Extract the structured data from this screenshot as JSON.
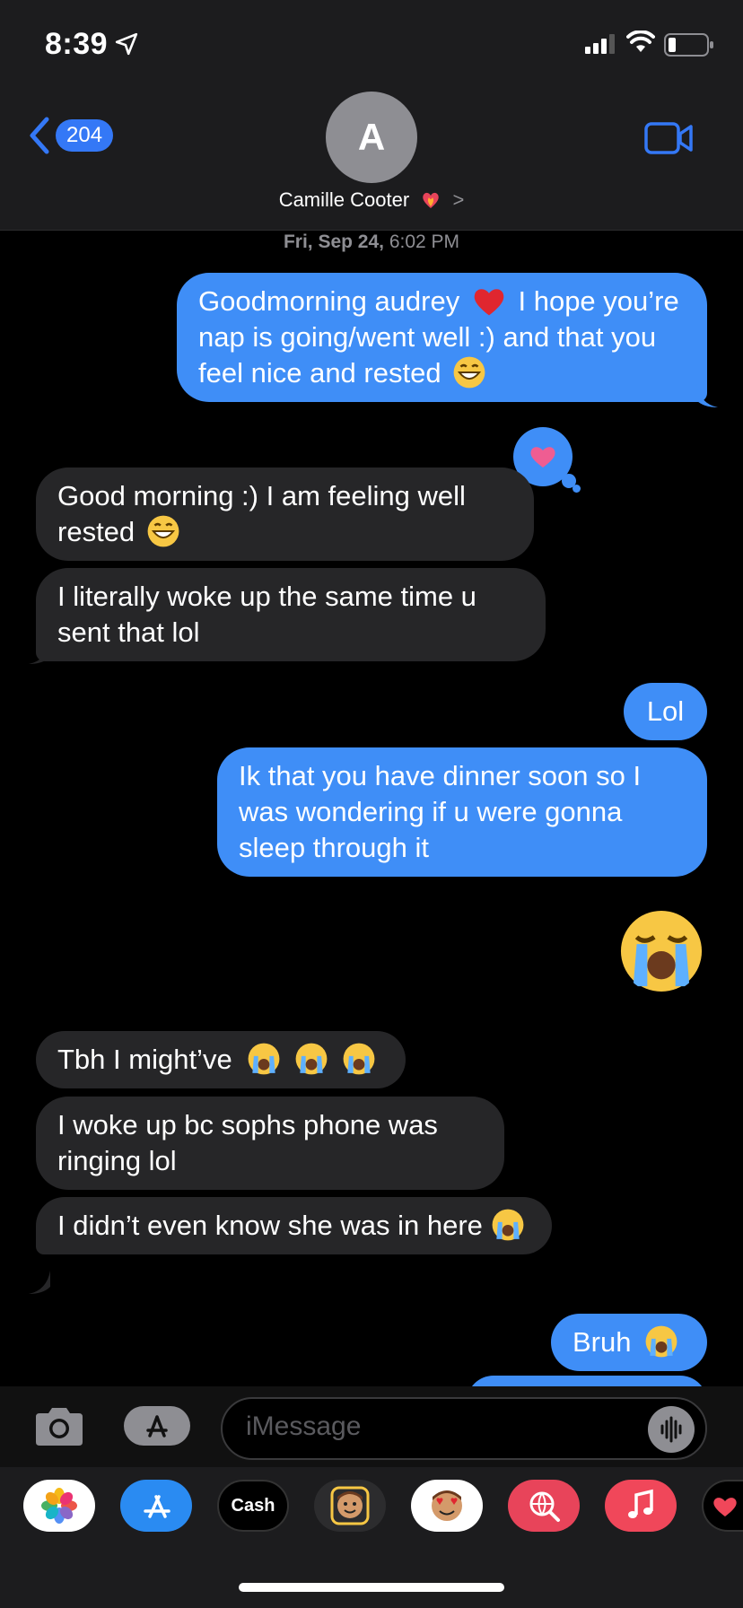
{
  "status_bar": {
    "time": "8:39"
  },
  "header": {
    "back_count": "204",
    "avatar_initial": "A",
    "contact_name": "Camille Cooter",
    "contact_chevron": ">"
  },
  "timestamp": {
    "day": "Fri, Sep 24,",
    "time": "6:02 PM"
  },
  "messages": [
    {
      "id": "m1",
      "direction": "sent",
      "text_a": "Goodmorning audrey",
      "text_b": "I hope you’re nap is going/went well :) and that you feel nice and rested"
    },
    {
      "id": "m2",
      "direction": "received",
      "text": "Good morning :) I am feeling well rested"
    },
    {
      "id": "m3",
      "direction": "received",
      "text": "I literally woke up the same time u sent that lol"
    },
    {
      "id": "m4",
      "direction": "sent",
      "text": "Lol"
    },
    {
      "id": "m5",
      "direction": "sent",
      "text": "Ik that you have dinner soon so I was wondering if u were gonna sleep through it"
    },
    {
      "id": "m6",
      "direction": "sent",
      "emoji": "loudly-crying-face"
    },
    {
      "id": "m7",
      "direction": "received",
      "text": "Tbh I might’ve"
    },
    {
      "id": "m8",
      "direction": "received",
      "text": "I woke up bc sophs phone was ringing lol"
    },
    {
      "id": "m9",
      "direction": "received",
      "text": "I didn’t even know she was in here"
    },
    {
      "id": "m10",
      "direction": "sent",
      "text": "Bruh"
    }
  ],
  "input": {
    "placeholder": "iMessage"
  },
  "app_drawer": {
    "apps": [
      {
        "name": "photos",
        "label": ""
      },
      {
        "name": "app-store",
        "label": ""
      },
      {
        "name": "apple-cash",
        "label": "Cash"
      },
      {
        "name": "memoji",
        "label": ""
      },
      {
        "name": "memoji-stickers",
        "label": ""
      },
      {
        "name": "images-search",
        "label": ""
      },
      {
        "name": "music",
        "label": ""
      },
      {
        "name": "digital-touch",
        "label": ""
      }
    ]
  },
  "colors": {
    "sent_bubble": "#3f8ef7",
    "received_bubble": "#262628",
    "accent": "#3478f6",
    "background": "#000000"
  }
}
